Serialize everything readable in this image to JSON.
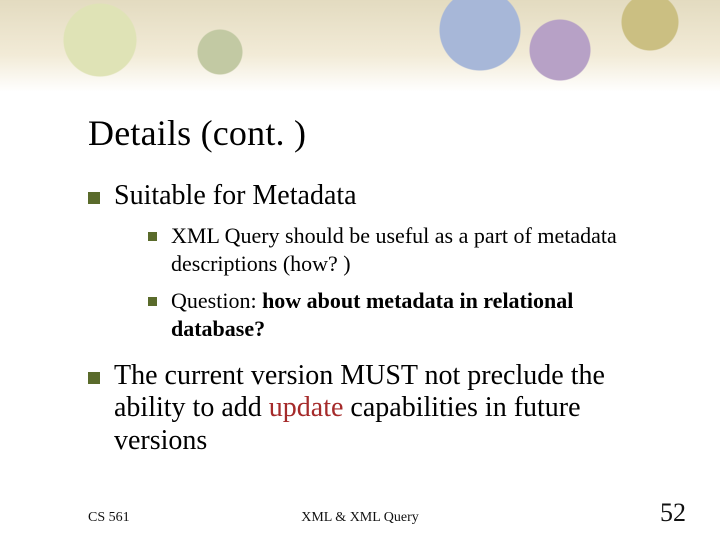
{
  "slide": {
    "title": "Details (cont. )",
    "bullets": [
      {
        "text": "Suitable for Metadata",
        "sub": [
          {
            "text": "XML Query should be useful as a part of metadata descriptions (how? )"
          },
          {
            "prefix": "Question: ",
            "bold": "how about metadata in relational database?"
          }
        ]
      },
      {
        "prefix": "The current version MUST not preclude the ability to add ",
        "red": "update",
        "suffix": " capabilities in future versions"
      }
    ]
  },
  "footer": {
    "left": "CS 561",
    "center": "XML & XML Query",
    "right": "52"
  }
}
